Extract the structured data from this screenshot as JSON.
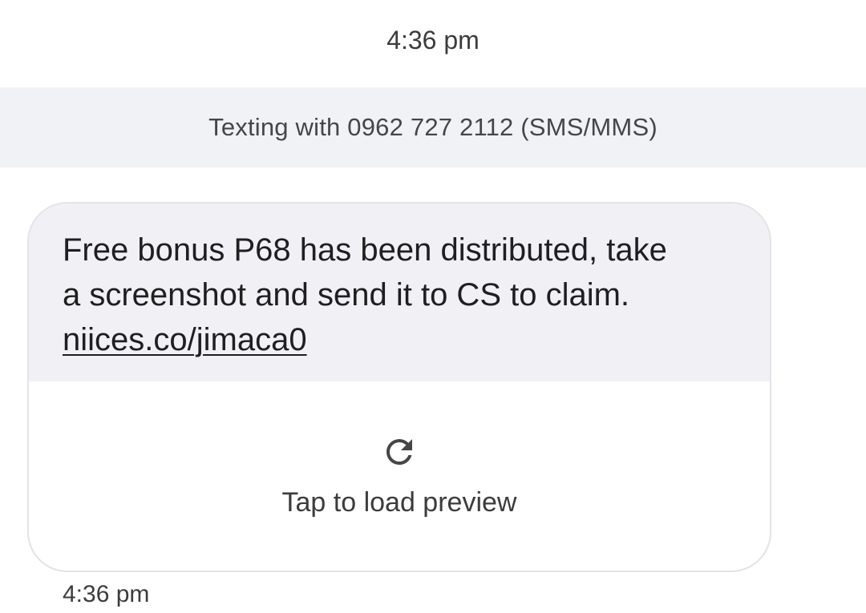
{
  "conversation": {
    "top_timestamp": "4:36 pm",
    "banner_text": "Texting with 0962 727 2112 (SMS/MMS)"
  },
  "message": {
    "body_line1": "Free bonus P68 has been distributed, take",
    "body_line2": "a screenshot and send it to CS to claim.",
    "link_text": "niices.co/jimaca0",
    "preview_label": "Tap to load preview",
    "preview_icon": "refresh-icon",
    "timestamp": "4:36 pm"
  },
  "colors": {
    "banner_bg": "#f1f2f6",
    "bubble_bg": "#f0f0f5",
    "text": "#1f1f1f"
  }
}
